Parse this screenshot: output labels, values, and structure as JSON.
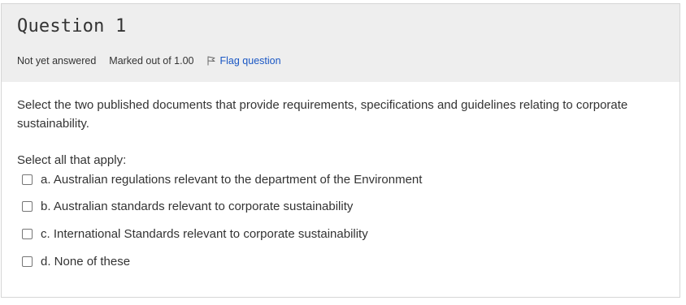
{
  "question": {
    "title": "Question 1",
    "state": "Not yet answered",
    "grade": "Marked out of 1.00",
    "flag_label": "Flag question",
    "text": "Select the two published documents that provide requirements, specifications and guidelines relating to corporate sustainability.",
    "prompt": "Select all that apply:",
    "options": [
      {
        "label": "a. Australian regulations relevant to the department of the Environment",
        "checked": false
      },
      {
        "label": "b. Australian standards relevant to corporate sustainability",
        "checked": false
      },
      {
        "label": "c. International Standards relevant to corporate sustainability",
        "checked": false
      },
      {
        "label": "d. None of these",
        "checked": false
      }
    ]
  },
  "colors": {
    "info_background": "#eeeeee",
    "link": "#1a57c4",
    "text": "#333333"
  }
}
